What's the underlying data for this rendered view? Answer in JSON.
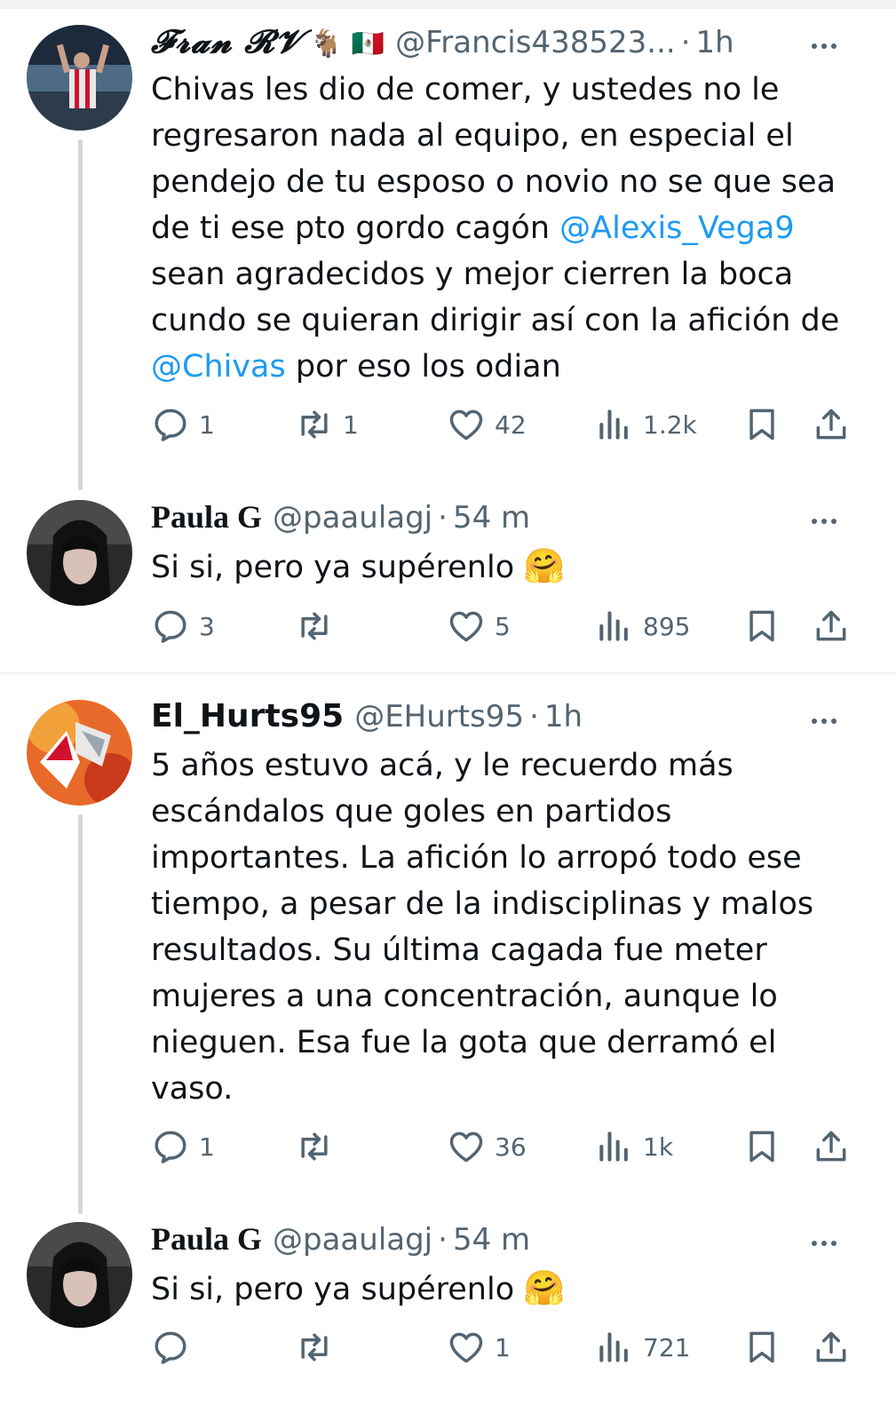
{
  "tweets": [
    {
      "name": "𝓕𝓻𝓪𝓷 𝓡𝓥",
      "name_emoji": "🐐 🇲🇽",
      "handle": "@Francis438523...",
      "time": "1h",
      "text_parts": [
        "Chivas les dio de comer, y ustedes no le regresaron nada al equipo, en especial el pendejo de tu esposo o novio no se que sea de ti ese pto gordo cagón ",
        "@Alexis_Vega9",
        " sean agradecidos y mejor cierren la boca cundo se quieran dirigir así con la afición de ",
        "@Chivas",
        " por eso los odian"
      ],
      "replies": "1",
      "retweets": "1",
      "likes": "42",
      "views": "1.2k"
    },
    {
      "name": "Paula G",
      "handle": "@paaulagj",
      "time": "54 m",
      "text": "Si si, pero ya supérenlo",
      "emoji": "🤗",
      "replies": "3",
      "retweets": "",
      "likes": "5",
      "views": "895"
    },
    {
      "name": "El_Hurts95",
      "handle": "@EHurts95",
      "time": "1h",
      "text": "5 años estuvo acá, y le recuerdo más escándalos que goles en partidos importantes. La afición lo arropó todo ese tiempo, a pesar de la indisciplinas y malos resultados. Su última cagada fue meter mujeres a una concentración, aunque lo nieguen. Esa fue la gota que derramó el vaso.",
      "replies": "1",
      "retweets": "",
      "likes": "36",
      "views": "1k"
    },
    {
      "name": "Paula G",
      "handle": "@paaulagj",
      "time": "54 m",
      "text": "Si si, pero ya supérenlo",
      "emoji": "🤗",
      "replies": "",
      "retweets": "",
      "likes": "1",
      "views": "721"
    }
  ],
  "dot": "·",
  "icons": [
    "reply-icon",
    "retweet-icon",
    "like-icon",
    "views-icon",
    "bookmark-icon",
    "share-icon",
    "more-icon"
  ],
  "colors": {
    "mention": "#1d9bf0",
    "secondary": "#536471",
    "thread": "#cfd9de"
  }
}
